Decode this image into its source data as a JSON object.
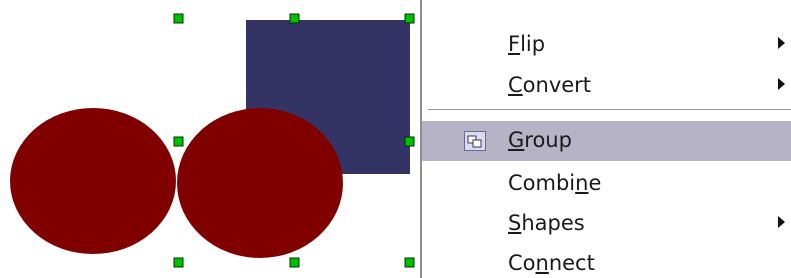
{
  "menu": {
    "items": [
      {
        "pre": "",
        "accel": "F",
        "post": "lip",
        "submenu": true
      },
      {
        "pre": "",
        "accel": "C",
        "post": "onvert",
        "submenu": true
      },
      {
        "pre": "",
        "accel": "G",
        "post": "roup",
        "submenu": false,
        "highlighted": true,
        "icon": "group-icon"
      },
      {
        "pre": "Combi",
        "accel": "n",
        "post": "e",
        "submenu": false
      },
      {
        "pre": "",
        "accel": "S",
        "post": "hapes",
        "submenu": true
      },
      {
        "pre": "Co",
        "accel": "n",
        "post": "nect",
        "submenu": false
      }
    ]
  },
  "canvas": {
    "shapes": [
      {
        "kind": "rectangle",
        "fill": "#333366"
      },
      {
        "kind": "circle",
        "fill": "#800000"
      },
      {
        "kind": "circle",
        "fill": "#800000"
      }
    ],
    "selection_handle_color": "#00c000"
  },
  "colors": {
    "highlight": "#b6b3c7",
    "menu_text": "#1a1a1a"
  }
}
